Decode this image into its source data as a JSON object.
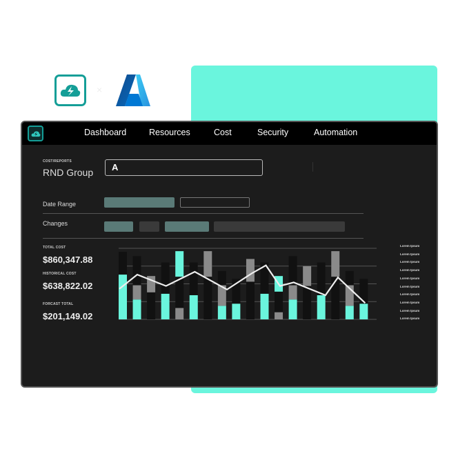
{
  "brand": {
    "separator": "×",
    "accent": "#6af5dd",
    "logo_teal": "#149e97"
  },
  "nav": {
    "items": [
      "Dashboard",
      "Resources",
      "Cost",
      "Security",
      "Automation"
    ]
  },
  "header": {
    "breadcrumb": "COST/REPORTS",
    "title": "RND Group",
    "search_value": "A"
  },
  "filters": {
    "date_range_label": "Date Range",
    "changes_label": "Changes"
  },
  "kpis": [
    {
      "label": "TOTAL COST",
      "value": "$860,347.88"
    },
    {
      "label": "HISTORICAL COST",
      "value": "$638,822.02"
    },
    {
      "label": "FORCAST TOTAL",
      "value": "$201,149.02"
    }
  ],
  "chart_data": {
    "type": "bar",
    "colors": {
      "current": "#6af5dd",
      "historical": "#8a8a8a",
      "background": "#111111",
      "line": "#eeeeee"
    },
    "ylim": [
      0,
      100
    ],
    "grid": true,
    "columns": [
      {
        "bg": 95,
        "segments": [
          {
            "kind": "current",
            "from": 0,
            "to": 63
          }
        ]
      },
      {
        "bg": 89,
        "segments": [
          {
            "kind": "current",
            "from": 0,
            "to": 28
          },
          {
            "kind": "historical",
            "from": 28,
            "to": 48
          }
        ]
      },
      {
        "bg": 61,
        "segments": [
          {
            "kind": "historical",
            "from": 38,
            "to": 61
          }
        ]
      },
      {
        "bg": 80,
        "segments": [
          {
            "kind": "current",
            "from": 0,
            "to": 36
          }
        ]
      },
      {
        "bg": 96,
        "segments": [
          {
            "kind": "historical",
            "from": 0,
            "to": 16
          },
          {
            "kind": "current",
            "from": 60,
            "to": 96
          }
        ]
      },
      {
        "bg": 80,
        "segments": [
          {
            "kind": "current",
            "from": 0,
            "to": 34
          }
        ]
      },
      {
        "bg": 96,
        "segments": [
          {
            "kind": "historical",
            "from": 60,
            "to": 96
          }
        ]
      },
      {
        "bg": 68,
        "segments": [
          {
            "kind": "current",
            "from": 0,
            "to": 19
          },
          {
            "kind": "historical",
            "from": 19,
            "to": 48
          }
        ]
      },
      {
        "bg": 57,
        "segments": [
          {
            "kind": "current",
            "from": 0,
            "to": 22
          }
        ]
      },
      {
        "bg": 85,
        "segments": [
          {
            "kind": "historical",
            "from": 53,
            "to": 85
          }
        ]
      },
      {
        "bg": 80,
        "segments": [
          {
            "kind": "current",
            "from": 0,
            "to": 36
          }
        ]
      },
      {
        "bg": 61,
        "segments": [
          {
            "kind": "historical",
            "from": 0,
            "to": 10
          },
          {
            "kind": "current",
            "from": 39,
            "to": 61
          }
        ]
      },
      {
        "bg": 89,
        "segments": [
          {
            "kind": "current",
            "from": 0,
            "to": 28
          },
          {
            "kind": "historical",
            "from": 28,
            "to": 48
          }
        ]
      },
      {
        "bg": 75,
        "segments": [
          {
            "kind": "historical",
            "from": 47,
            "to": 75
          }
        ]
      },
      {
        "bg": 80,
        "segments": [
          {
            "kind": "current",
            "from": 0,
            "to": 34
          }
        ]
      },
      {
        "bg": 96,
        "segments": [
          {
            "kind": "historical",
            "from": 60,
            "to": 96
          }
        ]
      },
      {
        "bg": 68,
        "segments": [
          {
            "kind": "current",
            "from": 0,
            "to": 19
          },
          {
            "kind": "historical",
            "from": 19,
            "to": 48
          }
        ]
      },
      {
        "bg": 57,
        "segments": [
          {
            "kind": "current",
            "from": 0,
            "to": 22
          }
        ]
      }
    ],
    "line": {
      "x": [
        -0.24,
        1.02,
        3.05,
        5.08,
        7.35,
        9.12,
        10.1,
        11.09,
        12.06,
        14.3,
        15.18,
        17.1
      ],
      "y": [
        43,
        63,
        47,
        67,
        42,
        65,
        76,
        47,
        52,
        34,
        59,
        23
      ]
    },
    "legend": [
      "Lorem Ipsum",
      "Lorem Ipsum",
      "Lorem Ipsum",
      "Lorem Ipsum",
      "Lorem Ipsum",
      "Lorem Ipsum",
      "Lorem Ipsum",
      "Lorem Ipsum",
      "Lorem Ipsum",
      "Lorem Ipsum"
    ]
  }
}
